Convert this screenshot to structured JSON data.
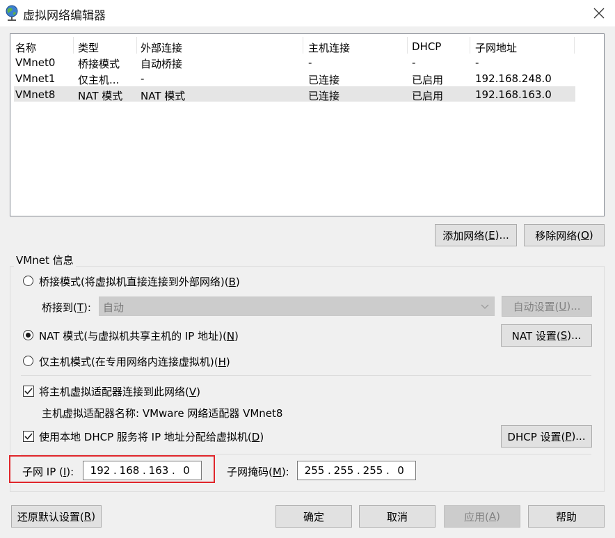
{
  "window": {
    "title": "虚拟网络编辑器"
  },
  "table": {
    "columns": [
      "名称",
      "类型",
      "外部连接",
      "主机连接",
      "DHCP",
      "子网地址"
    ],
    "rows": [
      [
        "VMnet0",
        "桥接模式",
        "自动桥接",
        "-",
        "-",
        "-"
      ],
      [
        "VMnet1",
        "仅主机...",
        "-",
        "已连接",
        "已启用",
        "192.168.248.0"
      ],
      [
        "VMnet8",
        "NAT 模式",
        "NAT 模式",
        "已连接",
        "已启用",
        "192.168.163.0"
      ]
    ],
    "selected_row": 2
  },
  "buttons": {
    "add_network": {
      "pre": "添加网络(",
      "key": "E",
      "post": ")..."
    },
    "remove_network": {
      "pre": "移除网络(",
      "key": "O",
      "post": ")"
    },
    "auto_settings": {
      "pre": "自动设置(",
      "key": "U",
      "post": ")..."
    },
    "nat_settings": {
      "pre": "NAT 设置(",
      "key": "S",
      "post": ")..."
    },
    "dhcp_settings": {
      "pre": "DHCP 设置(",
      "key": "P",
      "post": ")..."
    },
    "restore_defaults": {
      "pre": "还原默认设置(",
      "key": "R",
      "post": ")"
    },
    "ok": "确定",
    "cancel": "取消",
    "apply": {
      "pre": "应用(",
      "key": "A",
      "post": ")"
    },
    "help": "帮助"
  },
  "vmnet_info": {
    "group_label": "VMnet 信息",
    "bridged": {
      "pre": "桥接模式(将虚拟机直接连接到外部网络)(",
      "key": "B",
      "post": ")",
      "selected": false
    },
    "bridge_to": {
      "pre": "桥接到(",
      "key": "T",
      "post": "):",
      "value": "自动"
    },
    "nat": {
      "pre": "NAT 模式(与虚拟机共享主机的 IP 地址)(",
      "key": "N",
      "post": ")",
      "selected": true
    },
    "host_only": {
      "pre": "仅主机模式(在专用网络内连接虚拟机)(",
      "key": "H",
      "post": ")",
      "selected": false
    },
    "connect_adapter": {
      "pre": "将主机虚拟适配器连接到此网络(",
      "key": "V",
      "post": ")",
      "checked": true
    },
    "adapter_name": "主机虚拟适配器名称: VMware 网络适配器 VMnet8",
    "use_dhcp": {
      "pre": "使用本地 DHCP 服务将 IP 地址分配给虚拟机(",
      "key": "D",
      "post": ")",
      "checked": true
    },
    "subnet_ip": {
      "pre": "子网 IP (",
      "key": "I",
      "post": "):",
      "parts": [
        "192",
        "168",
        "163",
        "0"
      ]
    },
    "subnet_mask": {
      "pre": "子网掩码(",
      "key": "M",
      "post": "):",
      "parts": [
        "255",
        "255",
        "255",
        "0"
      ]
    }
  },
  "colors": {
    "highlight": "#e0262b",
    "selection": "#e5e5e5"
  }
}
